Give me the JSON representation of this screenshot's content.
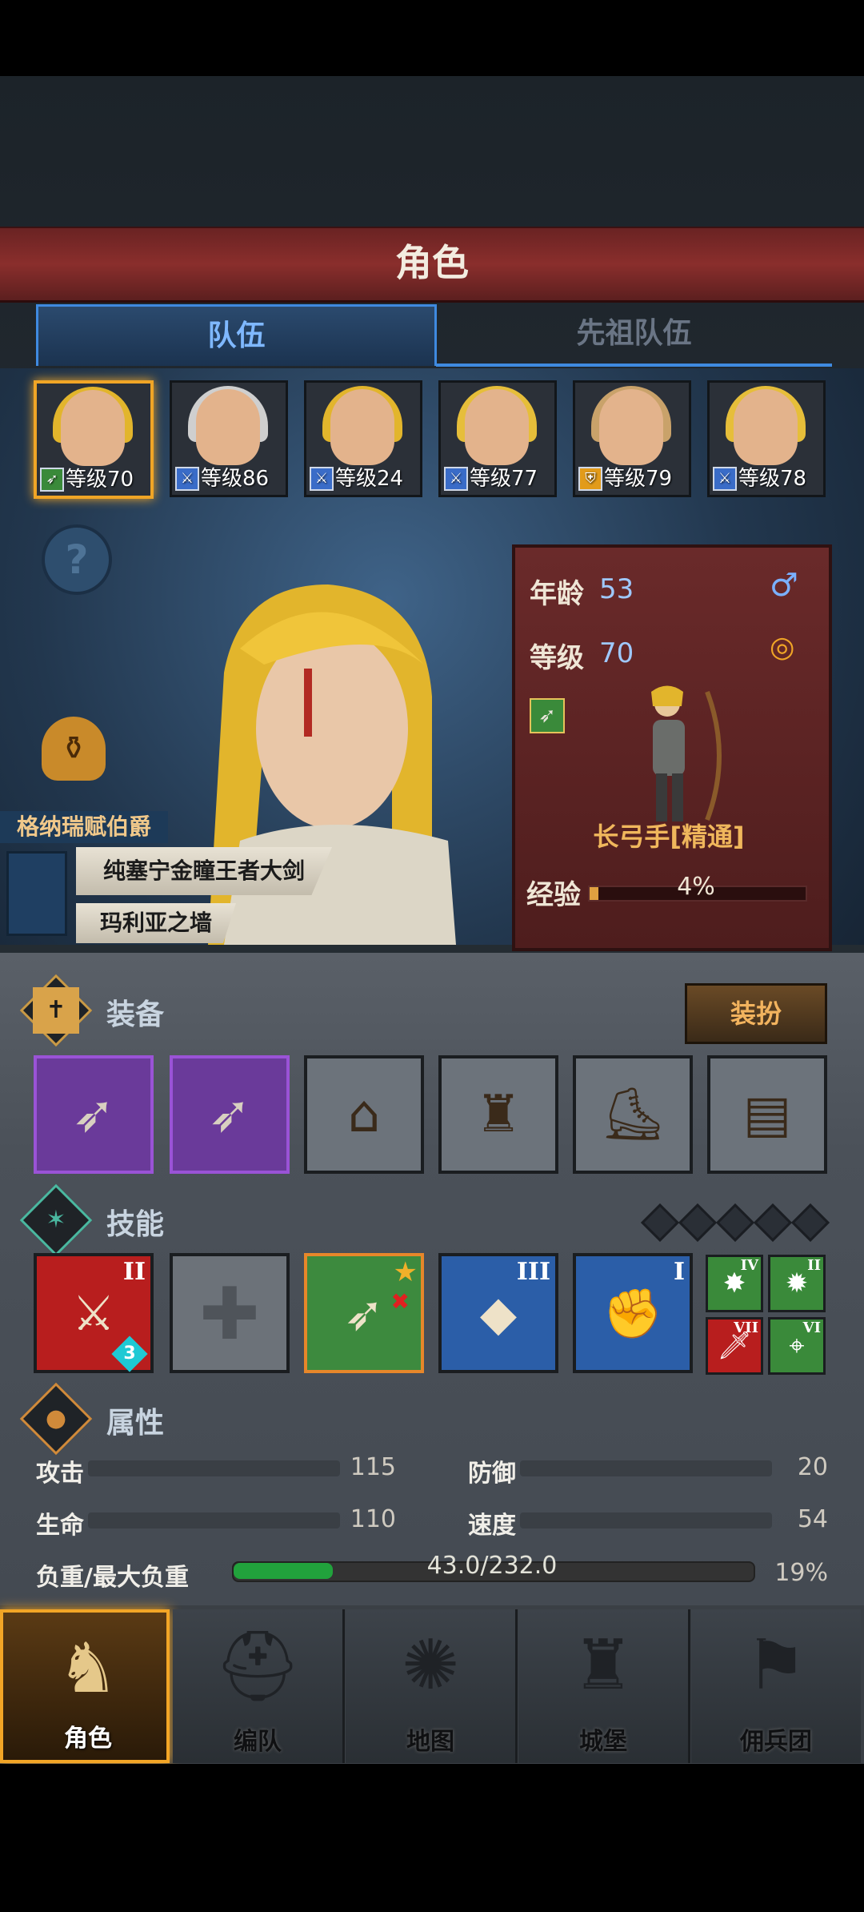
{
  "header": {
    "title": "角色"
  },
  "tabs": [
    {
      "label": "队伍"
    },
    {
      "label": "先祖队伍"
    }
  ],
  "party": [
    {
      "level_label": "等级70",
      "role_icon": "bow-icon",
      "hair": "#e2b52c"
    },
    {
      "level_label": "等级86",
      "role_icon": "sword-icon",
      "hair": "#cfcfcf"
    },
    {
      "level_label": "等级24",
      "role_icon": "sword-icon",
      "hair": "#e2b52c"
    },
    {
      "level_label": "等级77",
      "role_icon": "sword-icon",
      "hair": "#e6be3a"
    },
    {
      "level_label": "等级79",
      "role_icon": "shield-icon",
      "hair": "#c9a26a"
    },
    {
      "level_label": "等级78",
      "role_icon": "sword-icon",
      "hair": "#e6be3a"
    }
  ],
  "hero": {
    "owner": "格纳瑞赋伯爵",
    "weapon_banner": "纯塞宁金瞳王者大剑",
    "location_banner": "玛利亚之墙"
  },
  "stats": {
    "age_label": "年龄",
    "age_value": "53",
    "level_label": "等级",
    "level_value": "70",
    "class_name": "长弓手[精通]",
    "exp_label": "经验",
    "exp_percent": "4%",
    "exp_fraction": 0.04
  },
  "equipment": {
    "title": "装备",
    "dress_button": "装扮",
    "slots": [
      "bow",
      "bow",
      "hood",
      "coat",
      "boots",
      "book"
    ]
  },
  "skills": {
    "title": "技能",
    "main": [
      {
        "rank": "II",
        "badge": "3"
      },
      {
        "rank": ""
      },
      {
        "rank": ""
      },
      {
        "rank": "III"
      },
      {
        "rank": "I"
      }
    ],
    "mini": [
      {
        "rank": "IV"
      },
      {
        "rank": "II"
      },
      {
        "rank": "VII"
      },
      {
        "rank": "VI"
      }
    ]
  },
  "attributes": {
    "title": "属性",
    "attack_label": "攻击",
    "attack_value": "115",
    "defense_label": "防御",
    "defense_value": "20",
    "hp_label": "生命",
    "hp_value": "110",
    "speed_label": "速度",
    "speed_value": "54",
    "weight_label": "负重/最大负重",
    "weight_value": "43.0/232.0",
    "weight_percent": "19%",
    "weight_fraction": 0.19
  },
  "nav": [
    {
      "label": "角色"
    },
    {
      "label": "编队"
    },
    {
      "label": "地图"
    },
    {
      "label": "城堡"
    },
    {
      "label": "佣兵团"
    }
  ]
}
